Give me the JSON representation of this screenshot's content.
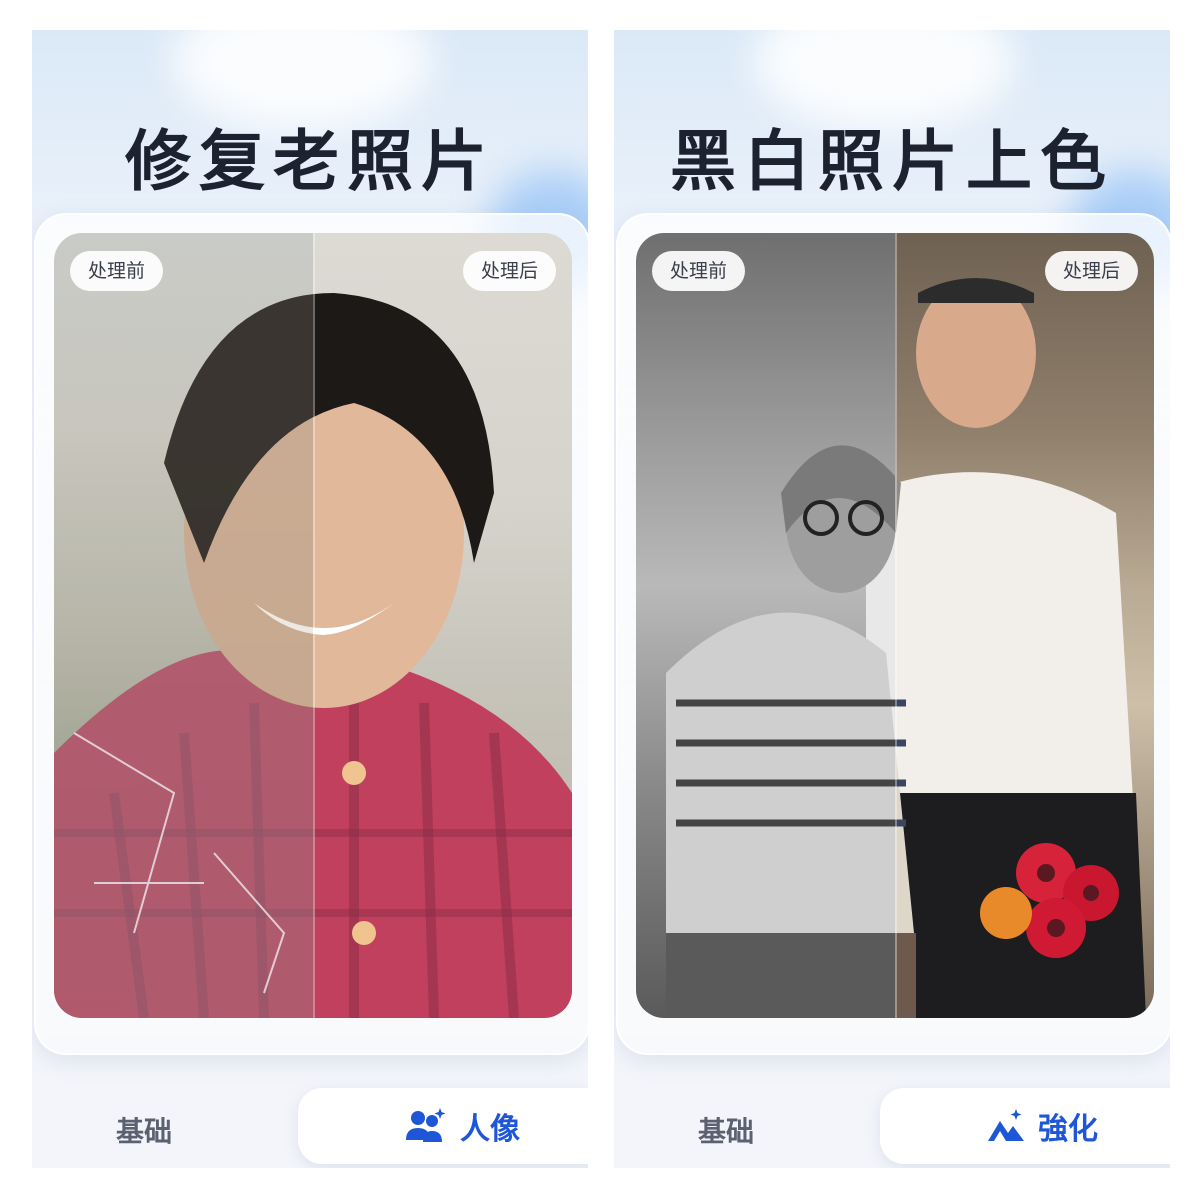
{
  "panels": [
    {
      "title": "修复老照片",
      "before_label": "处理前",
      "after_label": "处理后",
      "tabs": {
        "basic_label": "基础",
        "active_label": "人像",
        "active_icon": "people-sparkle-icon"
      }
    },
    {
      "title": "黑白照片上色",
      "before_label": "处理前",
      "after_label": "处理后",
      "tabs": {
        "basic_label": "基础",
        "active_label": "強化",
        "active_icon": "mountain-sparkle-icon"
      }
    }
  ],
  "colors": {
    "accent": "#1e56d8",
    "title_text": "#1d2230",
    "tab_text": "#5b6170"
  }
}
